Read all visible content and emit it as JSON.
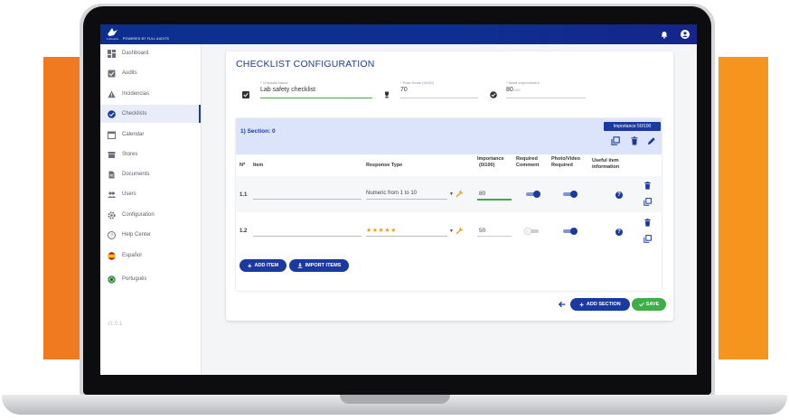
{
  "brand": {
    "logo_text": "FullAudits",
    "powered_by": "POWERED BY FULL AUDITS"
  },
  "colors": {
    "primary": "#1b3aa0",
    "topbar": "#0e2f91",
    "accent_orange": "#f07a20",
    "save_green": "#3fae47",
    "star": "#e4a51a"
  },
  "sidebar": {
    "items": [
      {
        "label": "Dashboard",
        "icon": "dashboard-icon"
      },
      {
        "label": "Audits",
        "icon": "audit-check-icon"
      },
      {
        "label": "Incidencias",
        "icon": "warning-icon"
      },
      {
        "label": "Checklists",
        "icon": "check-circle-icon",
        "active": true
      },
      {
        "label": "Calendar",
        "icon": "calendar-icon"
      },
      {
        "label": "Stores",
        "icon": "store-icon"
      },
      {
        "label": "Documents",
        "icon": "document-icon"
      },
      {
        "label": "Users",
        "icon": "users-icon"
      },
      {
        "label": "Configuration",
        "icon": "gear-icon"
      },
      {
        "label": "Help Center",
        "icon": "help-icon"
      },
      {
        "label": "Español",
        "icon": "spain-flag-icon"
      },
      {
        "label": "Português",
        "icon": "brazil-flag-icon"
      }
    ],
    "version": "v1.0.1"
  },
  "page": {
    "title": "CHECKLIST CONFIGURATION",
    "checklist_name_label": "* Checklist Name",
    "checklist_name_value": "Lab safety checklist",
    "pass_score_label": "* Pass Score (0/100)",
    "pass_score_value": "70",
    "need_improvement_label": "* Need Improvement",
    "need_improvement_value": "80",
    "need_improvement_suffix": "/100"
  },
  "section": {
    "title": "1) Section: 0",
    "importance_badge": "Importance 50/100",
    "columns": {
      "num": "Nº",
      "item": "Item",
      "response_type": "Response Type",
      "importance_1": "Importance",
      "importance_2": "(0/100)",
      "required_comment_1": "Required",
      "required_comment_2": "Comment",
      "photo_video_1": "Photo/Video",
      "photo_video_2": "Required",
      "useful_info_1": "Useful item",
      "useful_info_2": "information"
    },
    "rows": [
      {
        "num": "1.1",
        "response": "Numeric from 1 to 10",
        "importance": "80",
        "required_comment": true,
        "photo_required": true
      },
      {
        "num": "1.2",
        "response": "★★★★★",
        "importance": "50",
        "required_comment": false,
        "photo_required": true
      }
    ],
    "add_item_label": "ADD ITEM",
    "import_items_label": "IMPORT ITEMS"
  },
  "footer": {
    "add_section_label": "ADD SECTION",
    "save_label": "SAVE"
  }
}
